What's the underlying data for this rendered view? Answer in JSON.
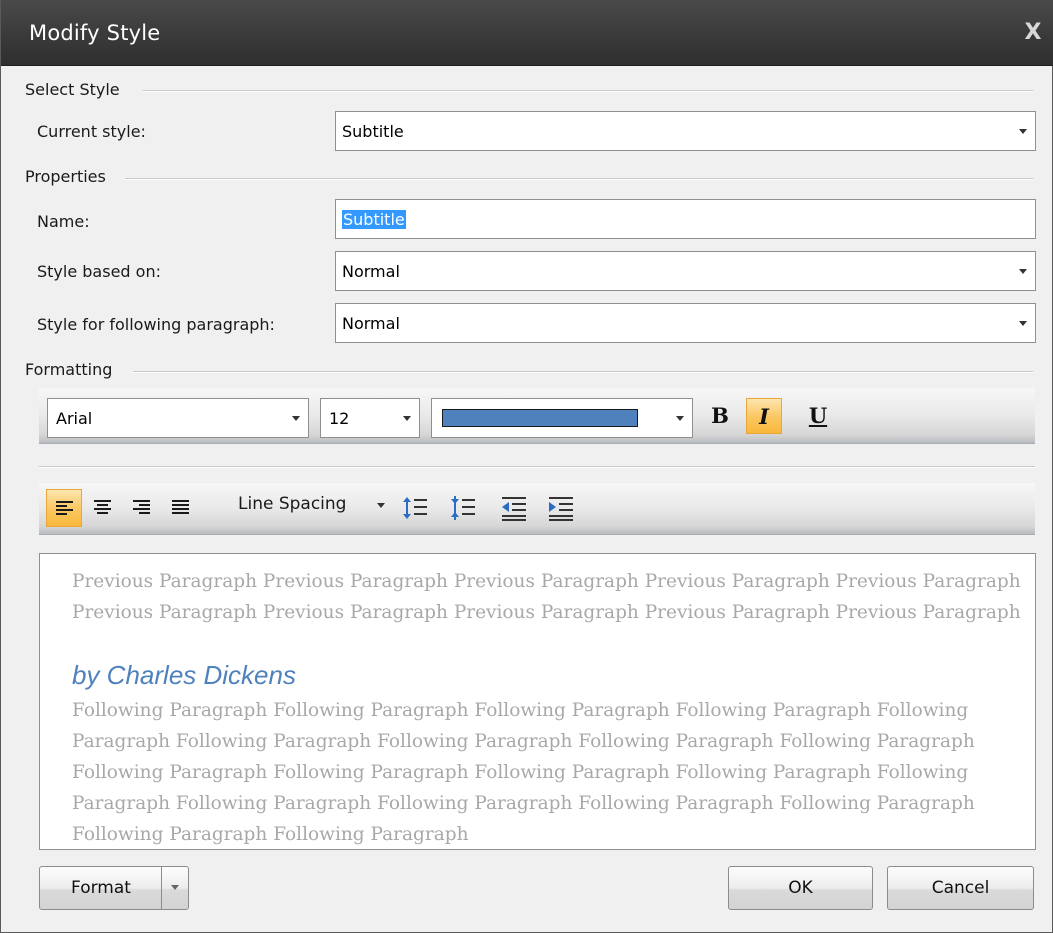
{
  "window": {
    "title": "Modify Style",
    "close_glyph": "X"
  },
  "select_style": {
    "section_label": "Select Style",
    "current_style_label": "Current style:",
    "current_style_value": "Subtitle"
  },
  "properties": {
    "section_label": "Properties",
    "name_label": "Name:",
    "name_value": "Subtitle",
    "based_on_label": "Style based on:",
    "based_on_value": "Normal",
    "following_label": "Style for following paragraph:",
    "following_value": "Normal"
  },
  "formatting": {
    "section_label": "Formatting",
    "font_name": "Arial",
    "font_size": "12",
    "font_color": "#4f81bd",
    "bold_label": "B",
    "italic_label": "I",
    "underline_label": "U",
    "italic_active": true,
    "alignment_active": "left",
    "line_spacing_label": "Line Spacing"
  },
  "preview": {
    "previous_text": "Previous Paragraph Previous Paragraph Previous Paragraph Previous Paragraph Previous Paragraph Previous Paragraph Previous Paragraph Previous Paragraph Previous Paragraph Previous Paragraph",
    "main_text": "by Charles Dickens",
    "following_text": "Following Paragraph Following Paragraph Following Paragraph Following Paragraph Following Paragraph Following Paragraph Following Paragraph Following Paragraph Following Paragraph Following Paragraph Following Paragraph Following Paragraph Following Paragraph Following Paragraph Following Paragraph Following Paragraph Following Paragraph Following Paragraph Following Paragraph Following Paragraph"
  },
  "buttons": {
    "format": "Format",
    "ok": "OK",
    "cancel": "Cancel"
  }
}
